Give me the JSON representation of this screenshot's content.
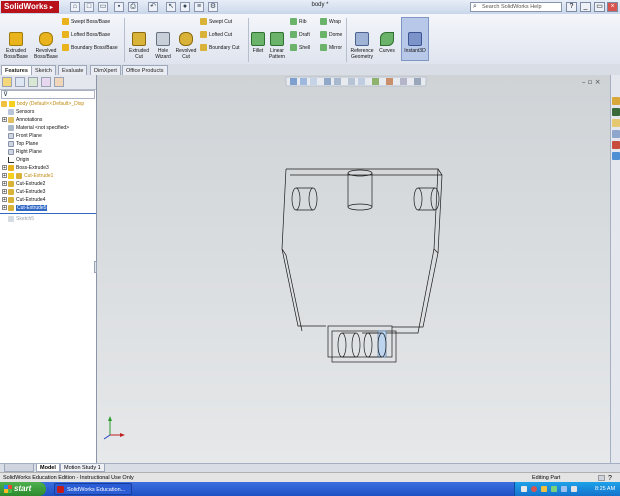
{
  "app": {
    "logo_text": "SolidWorks",
    "document_title": "body *"
  },
  "help_search": {
    "placeholder": "Search SolidWorks Help"
  },
  "commands": {
    "extruded_boss": "Extruded Boss/Base",
    "revolved_boss": "Revolved Boss/Base",
    "swept_boss": "Swept Boss/Base",
    "lofted_boss": "Lofted Boss/Base",
    "boundary_boss": "Boundary Boss/Base",
    "extruded_cut": "Extruded Cut",
    "hole_wizard": "Hole Wizard",
    "revolved_cut": "Revolved Cut",
    "swept_cut": "Swept Cut",
    "lofted_cut": "Lofted Cut",
    "boundary_cut": "Boundary Cut",
    "fillet": "Fillet",
    "linear_pattern": "Linear Pattern",
    "rib": "Rib",
    "draft": "Draft",
    "shell": "Shell",
    "wrap": "Wrap",
    "dome": "Dome",
    "mirror": "Mirror",
    "reference_geometry": "Reference Geometry",
    "curves": "Curves",
    "instant3d": "Instant3D"
  },
  "tabs": [
    "Features",
    "Sketch",
    "Evaluate",
    "DimXpert",
    "Office Products"
  ],
  "feature_tree": {
    "root": "body  (Default<<Default>_Disp",
    "items": [
      {
        "label": "Sensors"
      },
      {
        "label": "Annotations"
      },
      {
        "label": "Material <not specified>"
      },
      {
        "label": "Front Plane"
      },
      {
        "label": "Top Plane"
      },
      {
        "label": "Right Plane"
      },
      {
        "label": "Origin"
      },
      {
        "label": "Boss-Extrude3"
      },
      {
        "label": "Cut-Extrude1"
      },
      {
        "label": "Cut-Extrude2"
      },
      {
        "label": "Cut-Extrude3"
      },
      {
        "label": "Cut-Extrude4"
      },
      {
        "label": "Cut-Extrude5"
      },
      {
        "label": "Sketch5"
      }
    ]
  },
  "bottom_tabs": [
    "Model",
    "Motion Study 1"
  ],
  "status": {
    "left": "SolidWorks Education Edition - Instructional Use Only",
    "right": "Editing Part"
  },
  "taskbar": {
    "start": "start",
    "task": "SolidWorks Education...",
    "clock": "8:25 AM"
  },
  "colors": {
    "accent": "#316ac5",
    "brand": "#b8121b",
    "selection": "#316ac5"
  }
}
